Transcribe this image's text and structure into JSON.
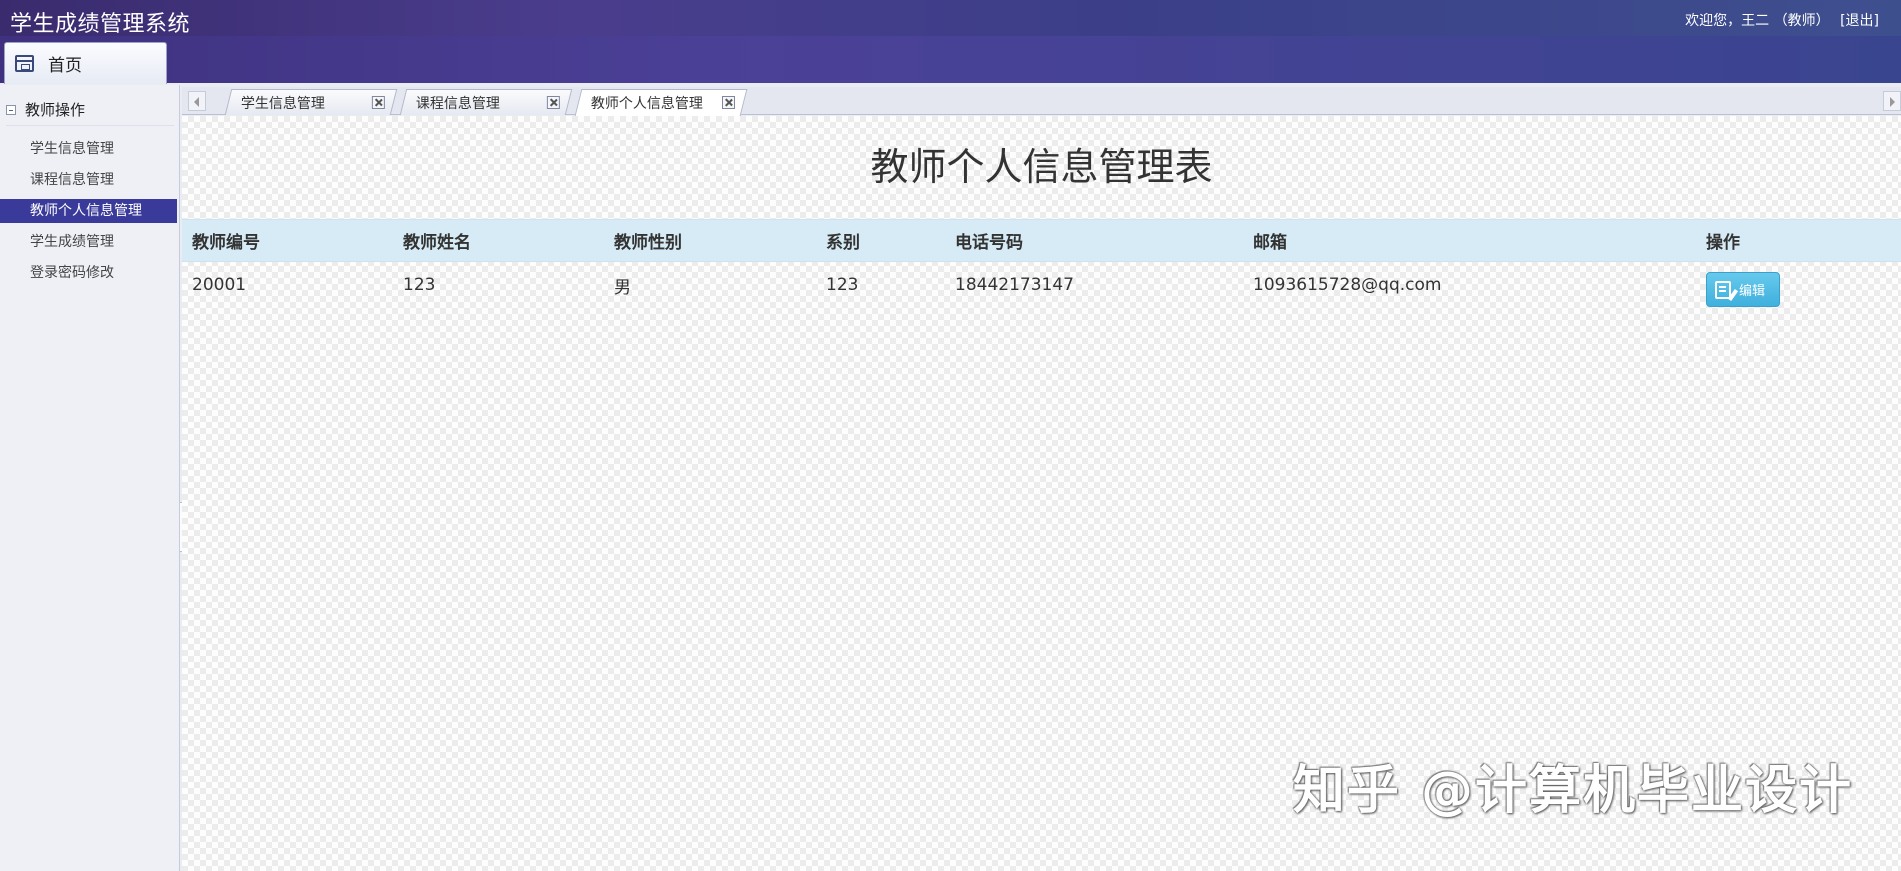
{
  "header": {
    "app_title": "学生成绩管理系统",
    "welcome_text": "欢迎您，王二 （教师）",
    "logout_label": "[退出]",
    "home_tab_label": "首页"
  },
  "sidebar": {
    "group_title": "教师操作",
    "items": [
      {
        "label": "学生信息管理"
      },
      {
        "label": "课程信息管理"
      },
      {
        "label": "教师个人信息管理"
      },
      {
        "label": "学生成绩管理"
      },
      {
        "label": "登录密码修改"
      }
    ],
    "active_index": 2
  },
  "tabs": [
    {
      "label": "学生信息管理"
    },
    {
      "label": "课程信息管理"
    },
    {
      "label": "教师个人信息管理"
    }
  ],
  "active_tab": 2,
  "main": {
    "title": "教师个人信息管理表",
    "columns": [
      "教师编号",
      "教师姓名",
      "教师性别",
      "系别",
      "电话号码",
      "邮箱",
      "操作"
    ],
    "rows": [
      {
        "id": "20001",
        "name": "123",
        "gender": "男",
        "department": "123",
        "phone": "18442173147",
        "email": "1093615728@qq.com",
        "action_label": "编辑"
      }
    ]
  },
  "watermark": "知乎 @计算机毕业设计",
  "colors": {
    "header_bg": "#3f3180",
    "active_menu": "#3a3a9a",
    "table_header_bg": "#d6ebf5",
    "edit_button": "#4bbbe4"
  }
}
